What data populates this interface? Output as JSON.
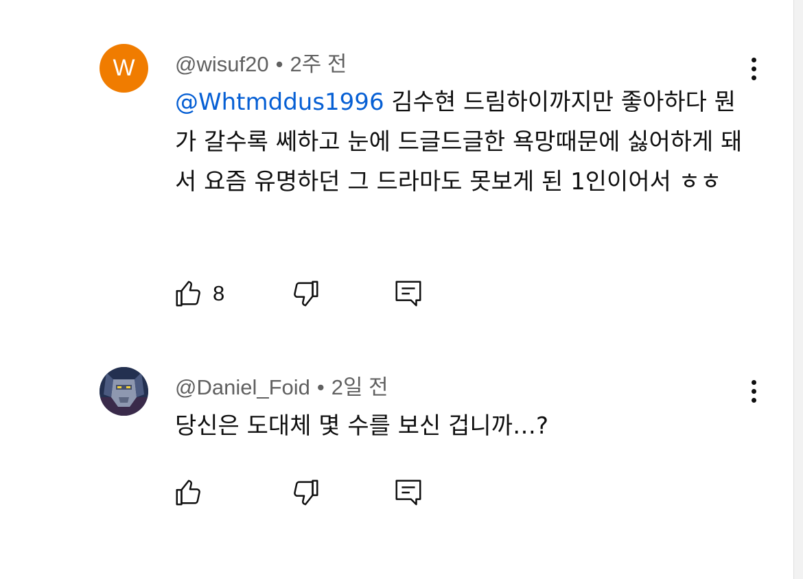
{
  "comments": [
    {
      "avatar": {
        "letter": "W",
        "color": "#f07c00"
      },
      "author": "@wisuf20",
      "separator": "•",
      "time": "2주 전",
      "mention": "@Whtmddus1996",
      "body": " 김수현 드림하이까지만 좋아하다 뭔가 갈수록 쎄하고 눈에 드글드글한 욕망때문에 싫어하게 돼서 요즘 유명하던 그 드라마도 못보게 된 1인이어서 ㅎㅎ",
      "likes": "8"
    },
    {
      "avatar": {
        "letter": "",
        "color": "#2b3350"
      },
      "author": "@Daniel_Foid",
      "separator": "•",
      "time": "2일 전",
      "mention": "",
      "body": "당신은 도대체 몇 수를 보신 겁니까…?",
      "likes": ""
    }
  ],
  "icons": {
    "like": "thumb-up-icon",
    "dislike": "thumb-down-icon",
    "reply": "reply-icon",
    "more": "more-vert-icon"
  }
}
